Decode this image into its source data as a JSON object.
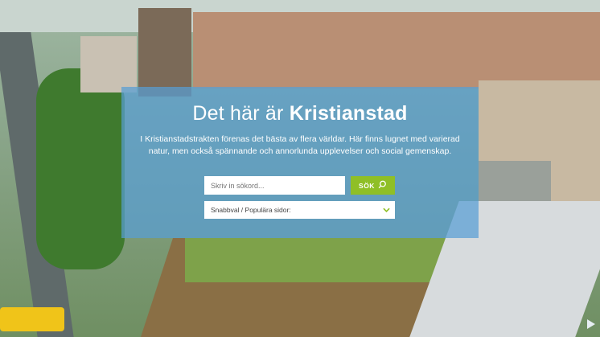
{
  "hero": {
    "title_prefix": "Det här är",
    "title_emphasis": "Kristianstad",
    "subtitle": "I Kristianstadstrakten förenas det bästa av flera världar. Här finns lugnet med varierad natur, men också spännande och annorlunda upplevelser och social gemenskap."
  },
  "search": {
    "placeholder": "Skriv in sökord...",
    "button_label": "SÖK",
    "button_icon": "search-icon"
  },
  "quick_select": {
    "selected": "Snabbval / Populära sidor:",
    "icon": "chevron-down-icon"
  },
  "video": {
    "control_icon": "play-icon"
  },
  "colors": {
    "panel": "#589ed4",
    "accent": "#8fbf26"
  }
}
